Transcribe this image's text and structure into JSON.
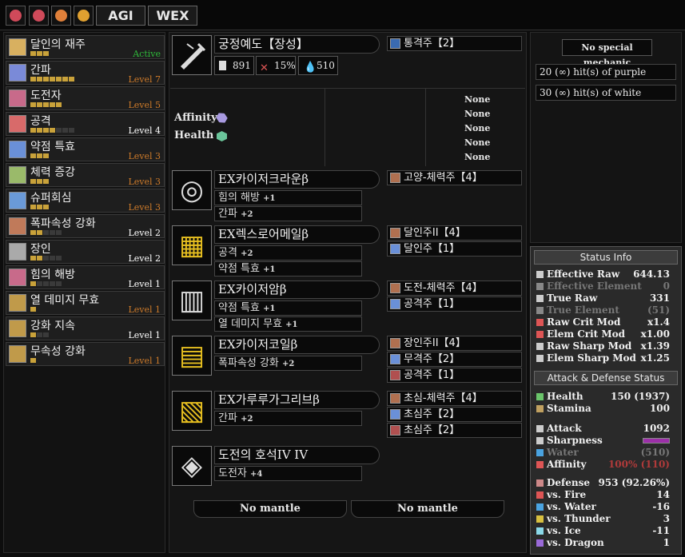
{
  "topbar": {
    "icons": [
      "skull-icon",
      "skull-icon",
      "skull-icon",
      "skull-icon"
    ],
    "btn1": "AGI",
    "btn2": "WEX"
  },
  "skills": [
    {
      "name": "달인의 재주",
      "level": "Active",
      "color": "#2fb83a",
      "pips": 3,
      "max": 3
    },
    {
      "name": "간파",
      "level": "Level 7",
      "color": "#cc7a2a",
      "pips": 7,
      "max": 7
    },
    {
      "name": "도전자",
      "level": "Level 5",
      "color": "#cc7a2a",
      "pips": 5,
      "max": 5
    },
    {
      "name": "공격",
      "level": "Level 4",
      "color": "#ffffff",
      "pips": 4,
      "max": 7
    },
    {
      "name": "약점 특효",
      "level": "Level 3",
      "color": "#cc7a2a",
      "pips": 3,
      "max": 3
    },
    {
      "name": "체력 증강",
      "level": "Level 3",
      "color": "#cc7a2a",
      "pips": 3,
      "max": 3
    },
    {
      "name": "슈퍼회심",
      "level": "Level 3",
      "color": "#cc7a2a",
      "pips": 3,
      "max": 3
    },
    {
      "name": "폭파속성 강화",
      "level": "Level 2",
      "color": "#ffffff",
      "pips": 2,
      "max": 5
    },
    {
      "name": "장인",
      "level": "Level 2",
      "color": "#ffffff",
      "pips": 2,
      "max": 5
    },
    {
      "name": "힘의 해방",
      "level": "Level 1",
      "color": "#ffffff",
      "pips": 1,
      "max": 5
    },
    {
      "name": "열 데미지 무효",
      "level": "Level 1",
      "color": "#cc7a2a",
      "pips": 1,
      "max": 1
    },
    {
      "name": "강화 지속",
      "level": "Level 1",
      "color": "#ffffff",
      "pips": 1,
      "max": 3
    },
    {
      "name": "무속성 강화",
      "level": "Level 1",
      "color": "#cc7a2a",
      "pips": 1,
      "max": 1
    }
  ],
  "weapon": {
    "name": "궁정예도【장성】",
    "attack": "891",
    "affinity": "15%",
    "element": "510",
    "deco": "통격주【2】",
    "affinity_label": "Affinity",
    "health_label": "Health",
    "none_values": [
      "None",
      "None",
      "None",
      "None",
      "None"
    ]
  },
  "armor": [
    {
      "name": "EX카이저크라운β",
      "skills": [
        {
          "label": "힘의 해방",
          "lv": "+1"
        },
        {
          "label": "간파",
          "lv": "+2"
        }
      ],
      "decos": [
        "고양-체력주【4】"
      ]
    },
    {
      "name": "EX렉스로어메일β",
      "skills": [
        {
          "label": "공격",
          "lv": "+2"
        },
        {
          "label": "약점 특효",
          "lv": "+1"
        }
      ],
      "decos": [
        "달인주II【4】",
        "달인주【1】"
      ]
    },
    {
      "name": "EX카이저암β",
      "skills": [
        {
          "label": "약점 특효",
          "lv": "+1"
        },
        {
          "label": "열 데미지 무효",
          "lv": "+1"
        }
      ],
      "decos": [
        "도전-체력주【4】",
        "공격주【1】"
      ]
    },
    {
      "name": "EX카이저코일β",
      "skills": [
        {
          "label": "폭파속성 강화",
          "lv": "+2"
        }
      ],
      "decos": [
        "장인주II【4】",
        "무격주【2】",
        "공격주【1】"
      ]
    },
    {
      "name": "EX가루루가그리브β",
      "skills": [
        {
          "label": "간파",
          "lv": "+2"
        }
      ],
      "decos": [
        "초심-체력주【4】",
        "초심주【2】",
        "초심주【2】"
      ]
    },
    {
      "name": "도전의 호석IV IV",
      "skills": [
        {
          "label": "도전자",
          "lv": "+4"
        }
      ],
      "decos": []
    }
  ],
  "mantles": [
    "No mantle",
    "No mantle"
  ],
  "mechanic": {
    "title": "No special mechanic",
    "hits1": "20 (∞) hit(s) of purple",
    "hits2": "30 (∞) hit(s) of white"
  },
  "status": {
    "title": "Status Info",
    "rows": [
      {
        "k": "Effective Raw",
        "v": "644.13"
      },
      {
        "k": "Effective Element",
        "v": "0",
        "dim": true
      },
      {
        "k": "True Raw",
        "v": "331"
      },
      {
        "k": "True Element",
        "v": "(51)",
        "dim": true
      },
      {
        "k": "Raw Crit Mod",
        "v": "x1.4"
      },
      {
        "k": "Elem Crit Mod",
        "v": "x1.00"
      },
      {
        "k": "Raw Sharp Mod",
        "v": "x1.39"
      },
      {
        "k": "Elem Sharp Mod",
        "v": "x1.25"
      }
    ],
    "title2": "Attack & Defense Status",
    "rows2": [
      {
        "k": "Health",
        "v": "150 (1937)"
      },
      {
        "k": "Stamina",
        "v": "100"
      }
    ],
    "rows3": [
      {
        "k": "Attack",
        "v": "1092"
      },
      {
        "k": "Sharpness",
        "v": ""
      },
      {
        "k": "Water",
        "v": "(510)",
        "dim": true
      },
      {
        "k": "Affinity",
        "v": "100% (110)",
        "red": true
      }
    ],
    "rows4": [
      {
        "k": "Defense",
        "v": "953 (92.26%)"
      },
      {
        "k": "vs. Fire",
        "v": "14"
      },
      {
        "k": "vs. Water",
        "v": "-16"
      },
      {
        "k": "vs. Thunder",
        "v": "3"
      },
      {
        "k": "vs. Ice",
        "v": "-11"
      },
      {
        "k": "vs. Dragon",
        "v": "1"
      }
    ]
  },
  "colors": {
    "accent_gold": "#c9a23a",
    "active_green": "#2fb83a",
    "level_orange": "#cc7a2a",
    "affinity_red": "#b03a3a",
    "sharp_purple": "#9c2fa8"
  }
}
